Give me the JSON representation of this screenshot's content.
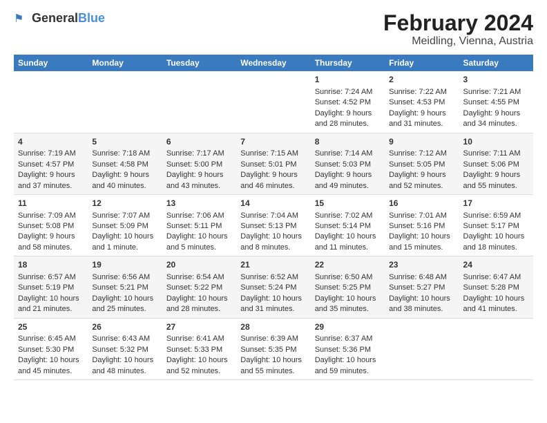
{
  "app": {
    "logo_general": "General",
    "logo_blue": "Blue"
  },
  "title": "February 2024",
  "subtitle": "Meidling, Vienna, Austria",
  "columns": [
    "Sunday",
    "Monday",
    "Tuesday",
    "Wednesday",
    "Thursday",
    "Friday",
    "Saturday"
  ],
  "weeks": [
    {
      "cells": [
        {
          "day": "",
          "content": ""
        },
        {
          "day": "",
          "content": ""
        },
        {
          "day": "",
          "content": ""
        },
        {
          "day": "",
          "content": ""
        },
        {
          "day": "1",
          "content": "Sunrise: 7:24 AM\nSunset: 4:52 PM\nDaylight: 9 hours\nand 28 minutes."
        },
        {
          "day": "2",
          "content": "Sunrise: 7:22 AM\nSunset: 4:53 PM\nDaylight: 9 hours\nand 31 minutes."
        },
        {
          "day": "3",
          "content": "Sunrise: 7:21 AM\nSunset: 4:55 PM\nDaylight: 9 hours\nand 34 minutes."
        }
      ]
    },
    {
      "cells": [
        {
          "day": "4",
          "content": "Sunrise: 7:19 AM\nSunset: 4:57 PM\nDaylight: 9 hours\nand 37 minutes."
        },
        {
          "day": "5",
          "content": "Sunrise: 7:18 AM\nSunset: 4:58 PM\nDaylight: 9 hours\nand 40 minutes."
        },
        {
          "day": "6",
          "content": "Sunrise: 7:17 AM\nSunset: 5:00 PM\nDaylight: 9 hours\nand 43 minutes."
        },
        {
          "day": "7",
          "content": "Sunrise: 7:15 AM\nSunset: 5:01 PM\nDaylight: 9 hours\nand 46 minutes."
        },
        {
          "day": "8",
          "content": "Sunrise: 7:14 AM\nSunset: 5:03 PM\nDaylight: 9 hours\nand 49 minutes."
        },
        {
          "day": "9",
          "content": "Sunrise: 7:12 AM\nSunset: 5:05 PM\nDaylight: 9 hours\nand 52 minutes."
        },
        {
          "day": "10",
          "content": "Sunrise: 7:11 AM\nSunset: 5:06 PM\nDaylight: 9 hours\nand 55 minutes."
        }
      ]
    },
    {
      "cells": [
        {
          "day": "11",
          "content": "Sunrise: 7:09 AM\nSunset: 5:08 PM\nDaylight: 9 hours\nand 58 minutes."
        },
        {
          "day": "12",
          "content": "Sunrise: 7:07 AM\nSunset: 5:09 PM\nDaylight: 10 hours\nand 1 minute."
        },
        {
          "day": "13",
          "content": "Sunrise: 7:06 AM\nSunset: 5:11 PM\nDaylight: 10 hours\nand 5 minutes."
        },
        {
          "day": "14",
          "content": "Sunrise: 7:04 AM\nSunset: 5:13 PM\nDaylight: 10 hours\nand 8 minutes."
        },
        {
          "day": "15",
          "content": "Sunrise: 7:02 AM\nSunset: 5:14 PM\nDaylight: 10 hours\nand 11 minutes."
        },
        {
          "day": "16",
          "content": "Sunrise: 7:01 AM\nSunset: 5:16 PM\nDaylight: 10 hours\nand 15 minutes."
        },
        {
          "day": "17",
          "content": "Sunrise: 6:59 AM\nSunset: 5:17 PM\nDaylight: 10 hours\nand 18 minutes."
        }
      ]
    },
    {
      "cells": [
        {
          "day": "18",
          "content": "Sunrise: 6:57 AM\nSunset: 5:19 PM\nDaylight: 10 hours\nand 21 minutes."
        },
        {
          "day": "19",
          "content": "Sunrise: 6:56 AM\nSunset: 5:21 PM\nDaylight: 10 hours\nand 25 minutes."
        },
        {
          "day": "20",
          "content": "Sunrise: 6:54 AM\nSunset: 5:22 PM\nDaylight: 10 hours\nand 28 minutes."
        },
        {
          "day": "21",
          "content": "Sunrise: 6:52 AM\nSunset: 5:24 PM\nDaylight: 10 hours\nand 31 minutes."
        },
        {
          "day": "22",
          "content": "Sunrise: 6:50 AM\nSunset: 5:25 PM\nDaylight: 10 hours\nand 35 minutes."
        },
        {
          "day": "23",
          "content": "Sunrise: 6:48 AM\nSunset: 5:27 PM\nDaylight: 10 hours\nand 38 minutes."
        },
        {
          "day": "24",
          "content": "Sunrise: 6:47 AM\nSunset: 5:28 PM\nDaylight: 10 hours\nand 41 minutes."
        }
      ]
    },
    {
      "cells": [
        {
          "day": "25",
          "content": "Sunrise: 6:45 AM\nSunset: 5:30 PM\nDaylight: 10 hours\nand 45 minutes."
        },
        {
          "day": "26",
          "content": "Sunrise: 6:43 AM\nSunset: 5:32 PM\nDaylight: 10 hours\nand 48 minutes."
        },
        {
          "day": "27",
          "content": "Sunrise: 6:41 AM\nSunset: 5:33 PM\nDaylight: 10 hours\nand 52 minutes."
        },
        {
          "day": "28",
          "content": "Sunrise: 6:39 AM\nSunset: 5:35 PM\nDaylight: 10 hours\nand 55 minutes."
        },
        {
          "day": "29",
          "content": "Sunrise: 6:37 AM\nSunset: 5:36 PM\nDaylight: 10 hours\nand 59 minutes."
        },
        {
          "day": "",
          "content": ""
        },
        {
          "day": "",
          "content": ""
        }
      ]
    }
  ]
}
